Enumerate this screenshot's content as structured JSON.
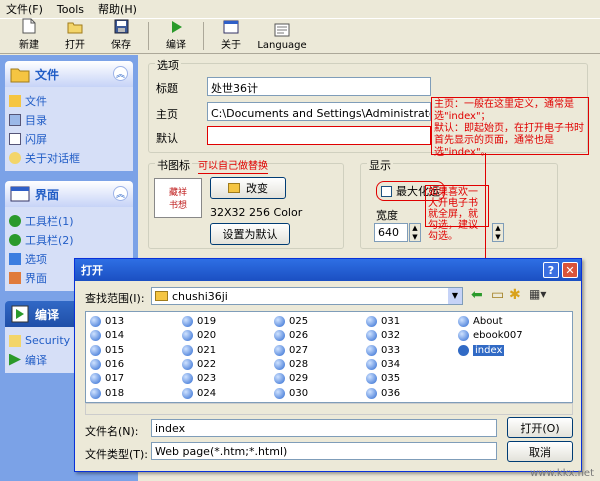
{
  "menu": [
    "文件(F)",
    "Tools",
    "帮助(H)"
  ],
  "toolbar": [
    {
      "label": "新建",
      "icon": "new-doc-icon"
    },
    {
      "label": "打开",
      "icon": "open-folder-icon"
    },
    {
      "label": "保存",
      "icon": "save-disk-icon"
    },
    {
      "label": "编译",
      "icon": "compile-play-icon"
    },
    {
      "label": "关于",
      "icon": "about-window-icon"
    },
    {
      "label": "Language",
      "icon": "language-globe-icon"
    }
  ],
  "nav": {
    "file_group": {
      "title": "文件",
      "items": [
        "文件",
        "目录",
        "闪屏",
        "关于对话框"
      ]
    },
    "ui_group": {
      "title": "界面",
      "items": [
        "工具栏(1)",
        "工具栏(2)",
        "选项",
        "界面"
      ]
    },
    "compile_group": {
      "title": "编译",
      "items": [
        "Security",
        "编译"
      ]
    }
  },
  "options": {
    "legend": "选项",
    "title_label": "标题",
    "title_value": "处世36计",
    "home_label": "主页",
    "home_value": "C:\\Documents and Settings\\Administrator\\桌面",
    "default_label": "默认",
    "default_value": ""
  },
  "annotation_home": "主页：一般在这里定义，通常是选\"index\"；\n默认：即起始页，在打开电子书时首先显示的页面，通常也是选\"index\"。",
  "icon_group": {
    "legend": "书图标",
    "hint": "可以自己做替换",
    "preview_text": "藏祥\n书想",
    "change_button": "改变",
    "size_info": "32X32 256 Color",
    "set_default_button": "设置为默认"
  },
  "display": {
    "legend": "显示",
    "maximize_label": "最大化运",
    "width_label": "宽度",
    "width_value": "640",
    "note": "如果喜欢一大开电子书就全屏，就勾选，建议勾选。"
  },
  "open_dialog": {
    "title": "打开",
    "look_in_label": "查找范围(I):",
    "look_in_value": "chushi36ji",
    "files": [
      "013",
      "014",
      "015",
      "016",
      "017",
      "018",
      "019",
      "020",
      "021",
      "022",
      "023",
      "024",
      "025",
      "026",
      "027",
      "028",
      "029",
      "030",
      "031",
      "032",
      "033",
      "034",
      "035",
      "036",
      "About",
      "ebook007",
      "index"
    ],
    "selected": "index",
    "filename_label": "文件名(N):",
    "filename_value": "index",
    "filetype_label": "文件类型(T):",
    "filetype_value": "Web page(*.htm;*.html)",
    "open_button": "打开(O)",
    "cancel_button": "取消"
  },
  "watermark": "www.kkx.net",
  "colors": {
    "accent": "#215dc6",
    "annotation": "#e00000",
    "selection": "#316ac5"
  }
}
